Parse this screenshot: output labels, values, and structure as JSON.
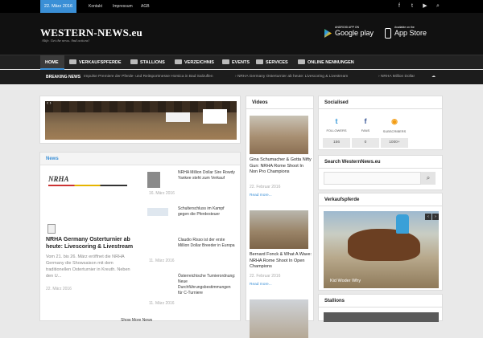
{
  "topbar": {
    "date": "22. März 2016",
    "links": [
      "Kontakt",
      "Impressum",
      "AGB"
    ],
    "social_icons": [
      "facebook-icon",
      "twitter-icon",
      "youtube-icon",
      "search-icon"
    ]
  },
  "header": {
    "logo": "WESTERN-NEWS.eu",
    "slogan": "Alife. Get the news. And actions!",
    "google_play_small": "ANDROID APP ON",
    "google_play_big": "Google play",
    "app_store_small": "Available on the",
    "app_store_big": "App Store"
  },
  "nav": {
    "items": [
      "HOME",
      "VERKAUFSPFERDE",
      "STALLIONS",
      "VERZEICHNIS",
      "EVENTS",
      "SERVICES",
      "ONLINE NENNUNGEN"
    ]
  },
  "breaking": {
    "label": "BREAKING NEWS",
    "items": [
      "Impulse Premiere der Pferde- und Reitsportmesse Horsica in Bad Salzuflen",
      "NRHA Germany Osterturnier ab heute: Livescoring & Livestream",
      "NRHA Million Dollar"
    ]
  },
  "news": {
    "title": "News",
    "lead": {
      "logo_text": "NRHA",
      "headline": "NRHA Germany Osterturnier ab heute: Livescoring & Livestream",
      "excerpt": "Vom 21. bis 26. März eröffnet die NRHA Germany die Showsaison mit dem traditionellen Osterturnier in Kreuth. Neben den U...",
      "date": "22. März 2016"
    },
    "items": [
      {
        "title": "NRHA Million Dollar Sire Rowdy Yankee steht zum Verkauf",
        "date": "16. März 2016"
      },
      {
        "title": "Schulterschluss im Kampf gegen die Pferdesteuer",
        "date": "16. März 2016"
      },
      {
        "title": "Claudio Risso ist der erste Million Dollar Breeder in Europa",
        "date": "11. März 2016"
      },
      {
        "title": "Österreichische Turnierordnung: Neue Durchführungsbestimmungen für C-Turniere",
        "date": "11. März 2016"
      }
    ],
    "more": "Show More News"
  },
  "videos": {
    "title": "Videos",
    "items": [
      {
        "title": "Gina Schumacher & Gotta Nifty Gun: NRHA Rome Shoot In Non Pro Champions",
        "date": "22. Februar 2016",
        "more": "Read more..."
      },
      {
        "title": "Bernard Fonck & What A Wave: NRHA Rome Shoot In Open Champions",
        "date": "22. Februar 2016",
        "more": "Read more..."
      }
    ]
  },
  "social": {
    "title": "Socialised",
    "boxes": [
      {
        "icon": "twitter-icon",
        "glyph": "t",
        "label": "FOLLOWERS",
        "count": "156",
        "color": "#3a9ad9"
      },
      {
        "icon": "facebook-icon",
        "glyph": "f",
        "label": "FANS",
        "count": "0",
        "color": "#3b5998"
      },
      {
        "icon": "rss-icon",
        "glyph": "◉",
        "label": "SUBSCRIBERS",
        "count": "1000+",
        "color": "#f39c12"
      }
    ]
  },
  "search": {
    "title": "Search WesternNews.eu",
    "placeholder": ""
  },
  "verkaufspferde": {
    "title": "Verkaufspferde",
    "caption": "Kid Woder Why"
  },
  "stallions": {
    "title": "Stallions"
  },
  "colors": {
    "accent": "#3a8fd6",
    "nav_bg": "#222222",
    "header_bg": "#111111"
  }
}
